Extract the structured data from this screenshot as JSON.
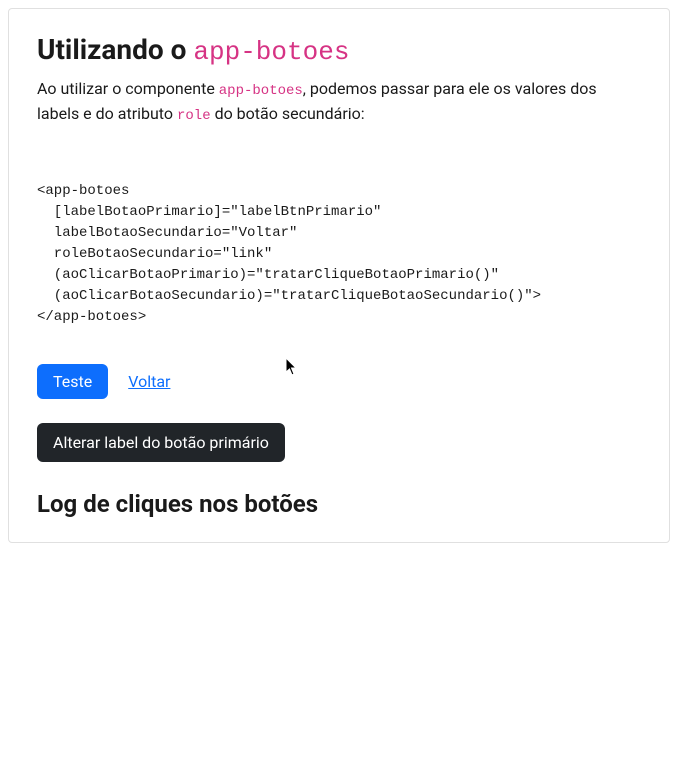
{
  "heading": {
    "prefix": "Utilizando o ",
    "code": "app-botoes"
  },
  "paragraph": {
    "part1": "Ao utilizar o componente ",
    "code1": "app-botoes",
    "part2": ", podemos passar para ele os valores dos labels e do atributo ",
    "code2": "role",
    "part3": " do botão secundário:"
  },
  "codeBlock": "<app-botoes\n  [labelBotaoPrimario]=\"labelBtnPrimario\"\n  labelBotaoSecundario=\"Voltar\"\n  roleBotaoSecundario=\"link\"\n  (aoClicarBotaoPrimario)=\"tratarCliqueBotaoPrimario()\"\n  (aoClicarBotaoSecundario)=\"tratarCliqueBotaoSecundario()\">\n</app-botoes>",
  "buttons": {
    "primary": "Teste",
    "secondary": "Voltar",
    "changeLabel": "Alterar label do botão primário"
  },
  "logHeading": "Log de cliques nos botões"
}
